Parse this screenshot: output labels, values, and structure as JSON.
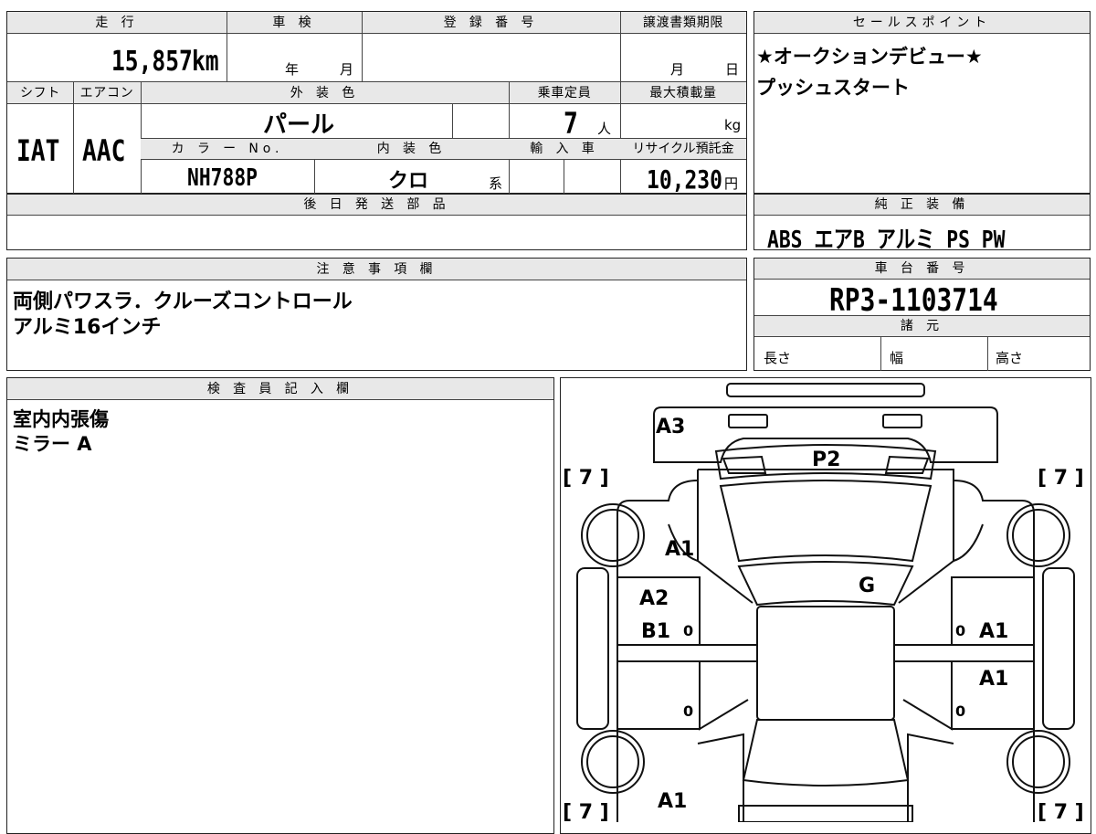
{
  "top_header": {
    "mileage_label": "走 行",
    "inspection_label": "車 検",
    "registration_label": "登 録 番 号",
    "transfer_deadline_label": "譲渡書類期限",
    "sales_point_label": "セールスポイント"
  },
  "mileage": {
    "value": "15,857",
    "unit": "km"
  },
  "inspection": {
    "year_unit": "年",
    "month_unit": "月"
  },
  "transfer_deadline": {
    "month_unit": "月",
    "day_unit": "日"
  },
  "row2_header": {
    "shift_label": "シフト",
    "aircon_label": "エアコン",
    "exterior_color_label": "外 装 色",
    "capacity_label": "乗車定員",
    "max_load_label": "最大積載量"
  },
  "shift": "IAT",
  "aircon": "AAC",
  "exterior_color": "パール",
  "capacity": {
    "value": "7",
    "unit": "人"
  },
  "max_load": {
    "unit": "kg"
  },
  "row3_header": {
    "color_no_label": "カ ラ ー No.",
    "interior_color_label": "内 装 色",
    "import_label": "輸 入 車",
    "recycle_label": "リサイクル預託金"
  },
  "color_no": "NH788P",
  "interior_color": {
    "value": "クロ",
    "suffix": "系"
  },
  "recycle_fee": {
    "value": "10,230",
    "unit": "円"
  },
  "later_parts": {
    "label": "後 日 発 送 部 品"
  },
  "sales_points": [
    "★オークションデビュー★",
    "プッシュスタート"
  ],
  "standard_equipment": {
    "label": "純 正 装 備",
    "value": "ABS エアB アルミ PS PW"
  },
  "notes": {
    "label": "注 意 事 項 欄",
    "lines": [
      "両側パワスラ．クルーズコントロール",
      "アルミ16インチ"
    ]
  },
  "chassis": {
    "label": "車 台 番 号",
    "value": "RP3-1103714"
  },
  "specs": {
    "label": "諸 元",
    "length_label": "長さ",
    "width_label": "幅",
    "height_label": "高さ"
  },
  "inspector": {
    "label": "検 査 員 記 入 欄",
    "lines": [
      "室内内張傷",
      "ミラー A"
    ]
  },
  "diagram": {
    "marks": {
      "rear_bumper": "A3",
      "rear_glass": "P2",
      "left_rear_fender": "A1",
      "roof": "G",
      "left_rear_door": "A2",
      "left_rear_door_2": "B1",
      "right_rear_door": "A1",
      "right_front_door": "A1",
      "front_bumper": "A1"
    },
    "tire_labels": [
      "[ 7 ]",
      "[ 7 ]",
      "[ 7 ]",
      "[ 7 ]"
    ],
    "zero_marks": [
      "0",
      "0",
      "0",
      "0"
    ]
  }
}
